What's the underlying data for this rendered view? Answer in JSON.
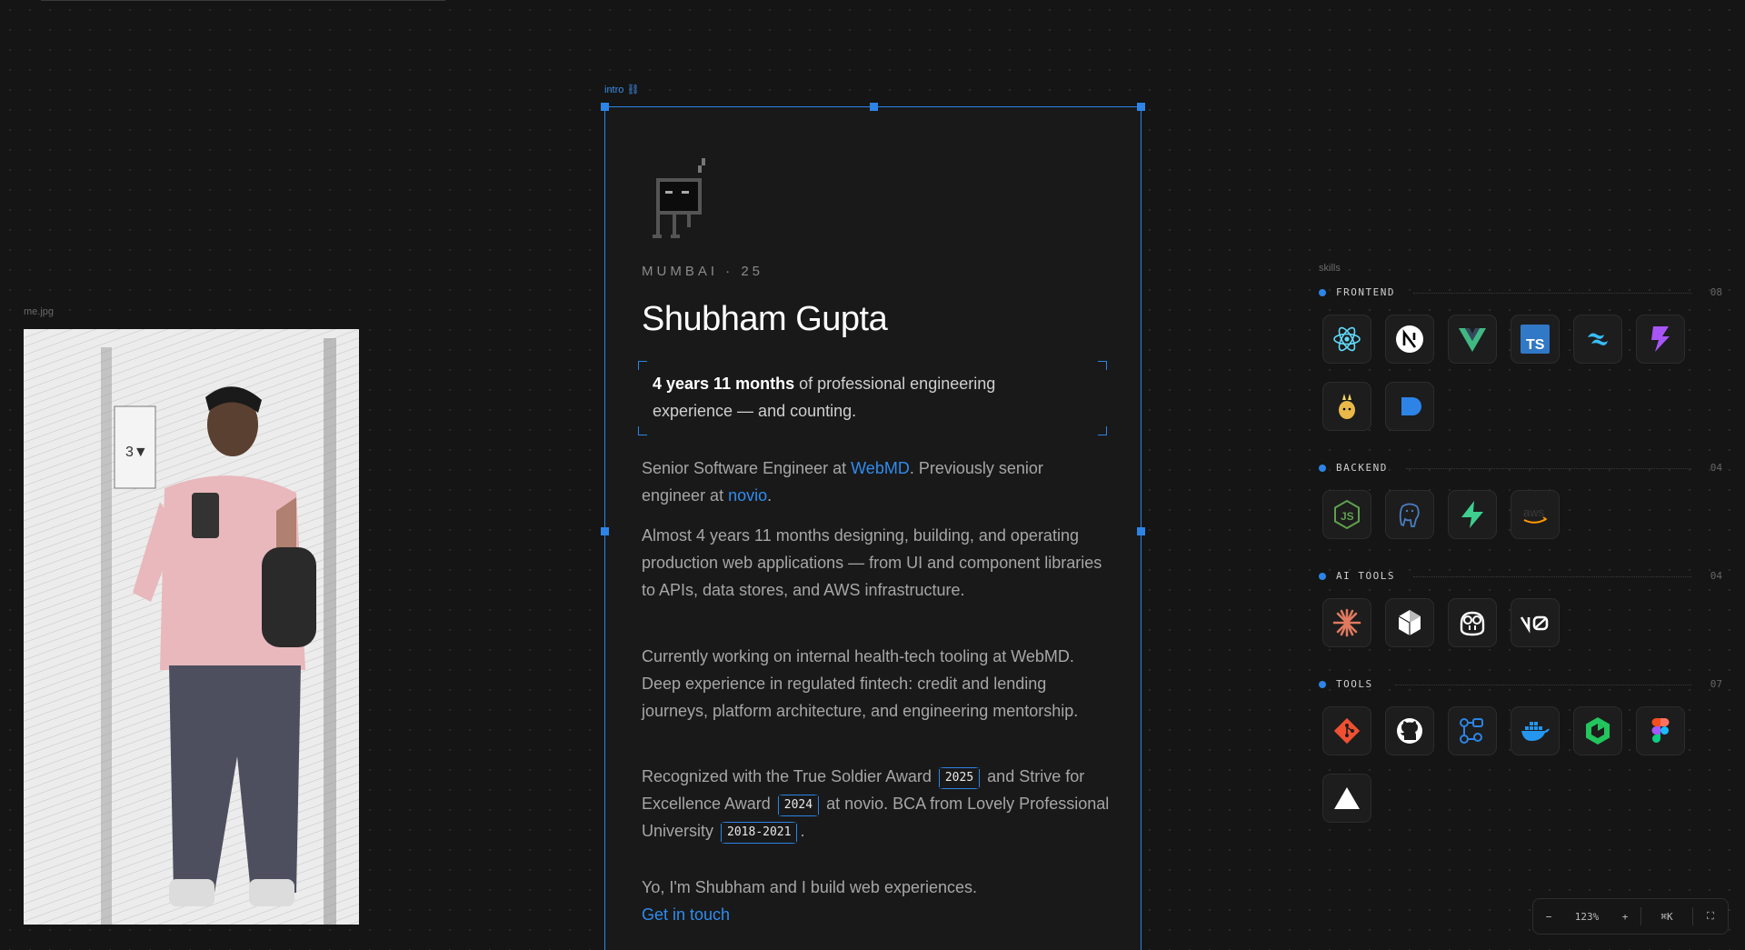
{
  "photo": {
    "label": "me.jpg"
  },
  "intro": {
    "label": "intro ⛓",
    "meta": "MUMBAI · 25",
    "name": "Shubham Gupta",
    "highlight_bold": "4 years 11 months",
    "highlight_rest": " of professional engineering experience — and counting.",
    "p1_a": "Senior Software Engineer at ",
    "p1_link1": "WebMD",
    "p1_b": ". Previously senior engineer at ",
    "p1_link2": "novio",
    "p1_c": ".",
    "p2": "Almost 4 years 11 months designing, building, and operating production web applications — from UI and component libraries to APIs, data stores, and AWS infrastructure.",
    "p3": "Currently working on internal health-tech tooling at WebMD. Deep experience in regulated fintech: credit and lending journeys, platform architecture, and engineering mentorship.",
    "p4_a": "Recognized with the True Soldier Award ",
    "p4_y1": "2025",
    "p4_b": " and Strive for Excellence Award ",
    "p4_y2": "2024",
    "p4_c": " at novio. BCA from Lovely Professional University ",
    "p4_y3": "2018-2021",
    "p4_d": ".",
    "p5": "Yo, I'm Shubham and I build web experiences.",
    "cta": "Get in touch"
  },
  "skills": {
    "label": "skills",
    "sections": [
      {
        "title": "FRONTEND",
        "count": "08",
        "icons": [
          "react-icon",
          "nextjs-icon",
          "vue-icon",
          "typescript-icon",
          "tailwind-icon",
          "vite-icon",
          "zustand-icon",
          "framer-icon"
        ]
      },
      {
        "title": "BACKEND",
        "count": "04",
        "icons": [
          "nodejs-icon",
          "postgresql-icon",
          "supabase-icon",
          "aws-icon"
        ]
      },
      {
        "title": "AI TOOLS",
        "count": "04",
        "icons": [
          "claude-icon",
          "cursor-icon",
          "copilot-icon",
          "v0-icon"
        ]
      },
      {
        "title": "TOOLS",
        "count": "07",
        "icons": [
          "git-icon",
          "github-icon",
          "github-actions-icon",
          "docker-icon",
          "cdk-icon",
          "figma-icon",
          "vercel-icon"
        ]
      }
    ]
  },
  "zoom": {
    "minus": "−",
    "level": "123%",
    "plus": "+",
    "shortcut": "⌘K",
    "fullscreen": "⛶"
  },
  "colors": {
    "accent": "#2d84e6",
    "background": "#151515",
    "card": "#191919"
  }
}
